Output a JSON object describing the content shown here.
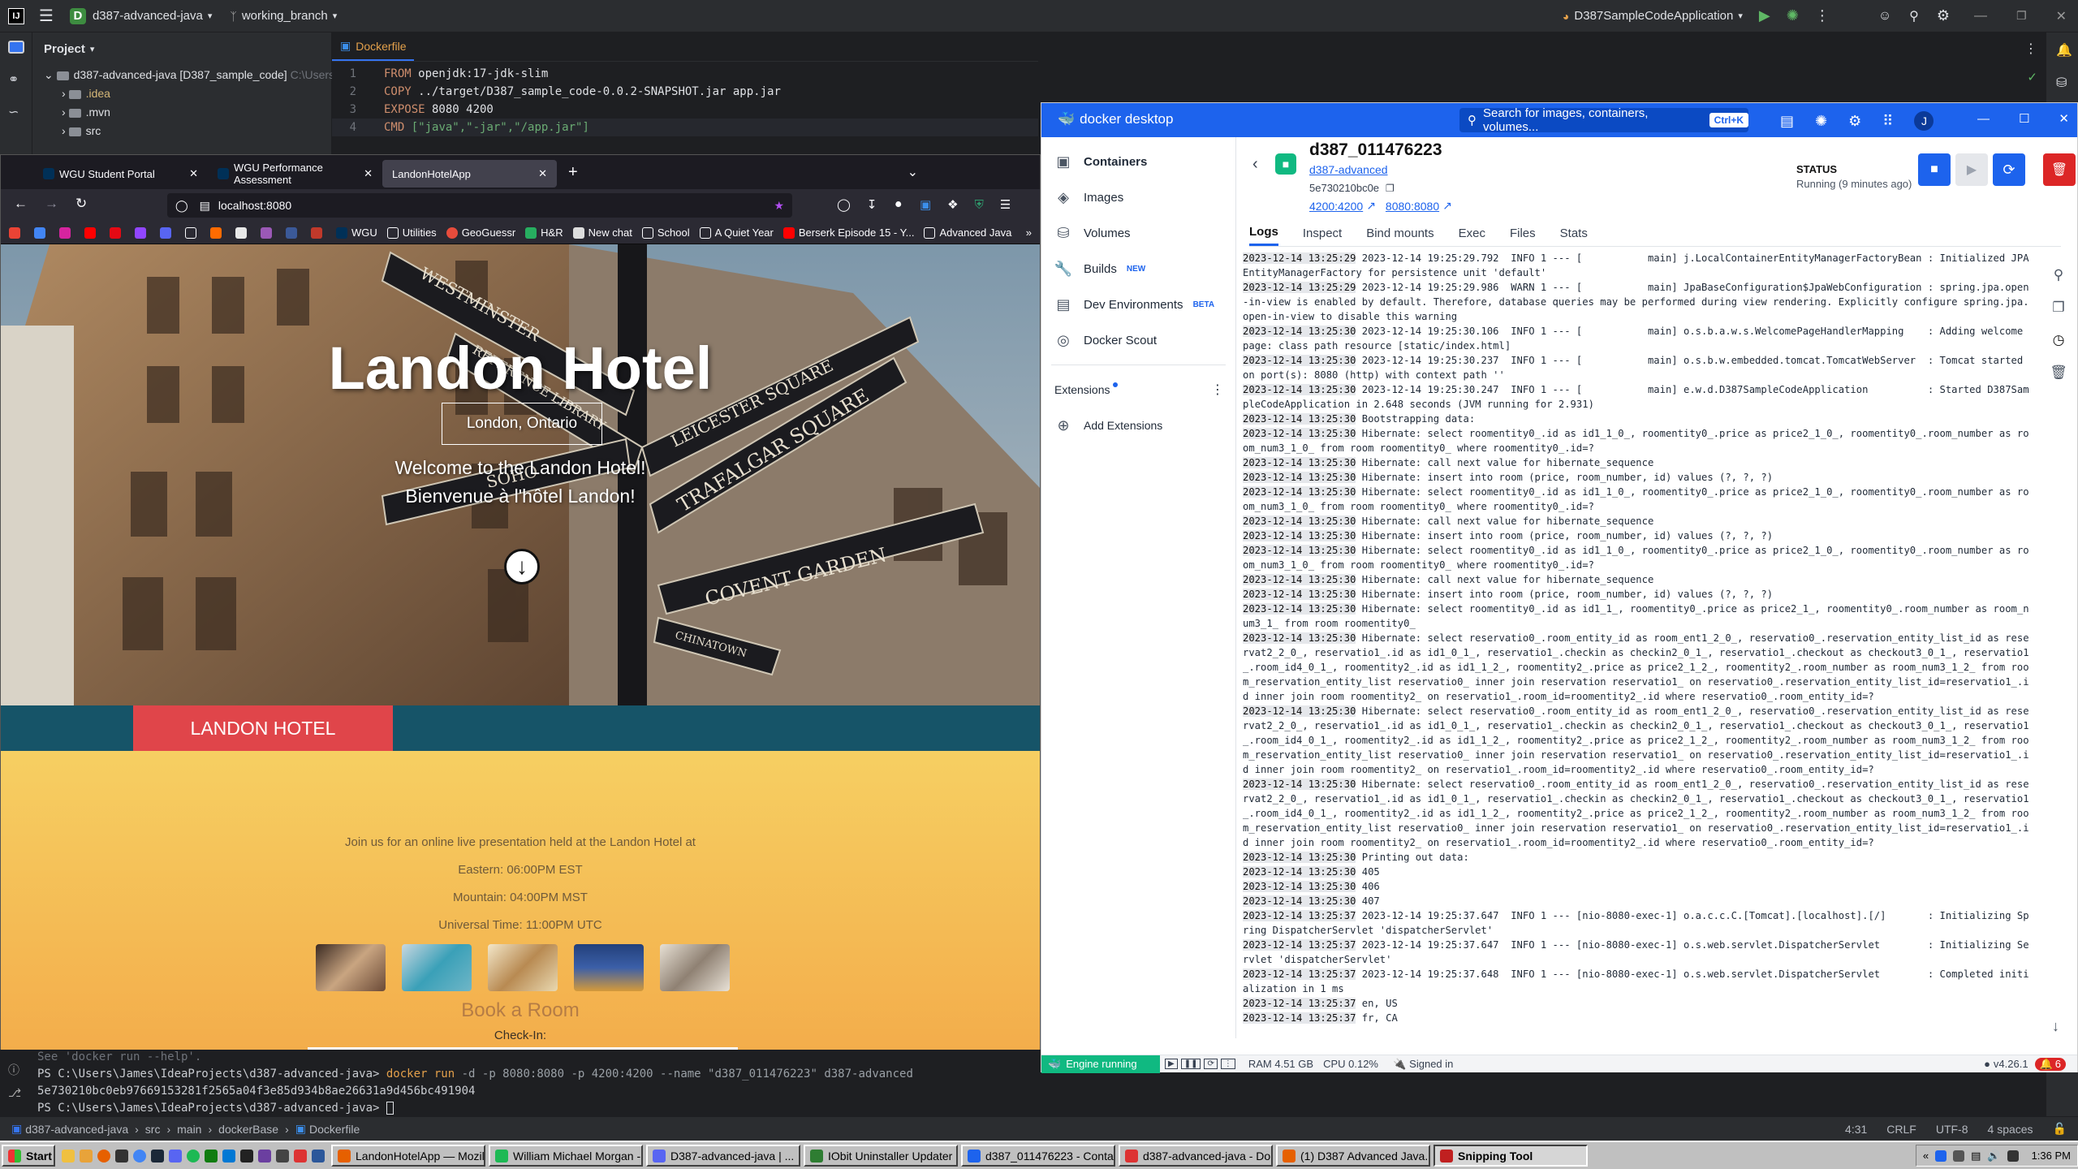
{
  "ide": {
    "project_name": "d387-advanced-java",
    "branch": "working_branch",
    "run_config": "D387SampleCodeApplication",
    "project_panel_title": "Project",
    "tree": [
      {
        "label": "d387-advanced-java [D387_sample_code]",
        "path": "C:\\Users"
      },
      {
        "label": ".idea"
      },
      {
        "label": ".mvn"
      },
      {
        "label": "src"
      }
    ],
    "editor_tab": "Dockerfile",
    "code_lines": [
      {
        "n": "1",
        "kw": "FROM",
        "rest": " openjdk:17-jdk-slim"
      },
      {
        "n": "2",
        "kw": "COPY",
        "rest": " ../target/D387_sample_code-0.0.2-SNAPSHOT.jar app.jar"
      },
      {
        "n": "3",
        "kw": "EXPOSE",
        "rest": " 8080 4200"
      },
      {
        "n": "4",
        "kw": "CMD",
        "rest": " [\"java\",\"-jar\",\"/app.jar\"]"
      }
    ],
    "terminal": {
      "line0": "See 'docker run --help'.",
      "prompt1": "PS C:\\Users\\James\\IdeaProjects\\d387-advanced-java> ",
      "cmd1": "docker run",
      "args1": " -d -p 8080:8080 -p 4200:4200 --name \"d387_011476223\" d387-advanced",
      "hash": "5e730210bc0eb97669153281f2565a04f3e85d934b8ae26631a9d456bc491904",
      "prompt2": "PS C:\\Users\\James\\IdeaProjects\\d387-advanced-java> "
    },
    "breadcrumbs": [
      "d387-advanced-java",
      "src",
      "main",
      "dockerBase",
      "Dockerfile"
    ],
    "status_right": {
      "pos": "4:31",
      "eol": "CRLF",
      "enc": "UTF-8",
      "indent": "4 spaces"
    }
  },
  "firefox": {
    "tabs": [
      "WGU Student Portal",
      "WGU Performance Assessment",
      "LandonHotelApp"
    ],
    "url": "localhost:8080",
    "bookmarks": [
      "WGU",
      "Utilities",
      "GeoGuessr",
      "H&R",
      "New chat",
      "School",
      "A Quiet Year",
      "Berserk Episode 15 - Y...",
      "Advanced Java"
    ],
    "site": {
      "title": "Landon Hotel",
      "location": "London, Ontario",
      "welcome_en": "Welcome to the Landon Hotel!",
      "welcome_fr": "Bienvenue à l'hôtel Landon!",
      "banner": "LANDON HOTEL",
      "event_intro": "Join us for an online live presentation held at the Landon Hotel at",
      "times": [
        "Eastern: 06:00PM EST",
        "Mountain: 04:00PM MST",
        "Universal Time: 11:00PM UTC"
      ],
      "book_title": "Book a Room",
      "checkin_label": "Check-In:",
      "signs": [
        "WESTMINSTER",
        "REFERENCE LIBRARY",
        "LEICESTER SQUARE",
        "TRAFALGAR SQUARE",
        "SOHO",
        "COVENT GARDEN",
        "CHINATOWN"
      ]
    }
  },
  "docker": {
    "app_title": "docker desktop",
    "search_placeholder": "Search for images, containers, volumes...",
    "search_shortcut": "Ctrl+K",
    "avatar": "J",
    "nav": [
      {
        "label": "Containers",
        "icon": "containers-icon"
      },
      {
        "label": "Images",
        "icon": "images-icon"
      },
      {
        "label": "Volumes",
        "icon": "volumes-icon"
      },
      {
        "label": "Builds",
        "icon": "builds-icon",
        "badge": "NEW"
      },
      {
        "label": "Dev Environments",
        "icon": "dev-env-icon",
        "badge": "BETA"
      },
      {
        "label": "Docker Scout",
        "icon": "scout-icon"
      }
    ],
    "extensions_label": "Extensions",
    "add_extensions": "Add Extensions",
    "container": {
      "name": "d387_011476223",
      "image": "d387-advanced",
      "id": "5e730210bc0e",
      "port1": "4200:4200",
      "port2": "8080:8080",
      "status_label": "STATUS",
      "status": "Running (9 minutes ago)"
    },
    "tabs": [
      "Logs",
      "Inspect",
      "Bind mounts",
      "Exec",
      "Files",
      "Stats"
    ],
    "logs": [
      {
        "ts": "2023-12-14 13:25:29",
        "msg": " 2023-12-14 19:25:29.792  INFO 1 --- [           main] j.LocalContainerEntityManagerFactoryBean : Initialized JPA EntityManagerFactory for persistence unit 'default'"
      },
      {
        "ts": "2023-12-14 13:25:29",
        "msg": " 2023-12-14 19:25:29.986  WARN 1 --- [           main] JpaBaseConfiguration$JpaWebConfiguration : spring.jpa.open-in-view is enabled by default. Therefore, database queries may be performed during view rendering. Explicitly configure spring.jpa.open-in-view to disable this warning"
      },
      {
        "ts": "2023-12-14 13:25:30",
        "msg": " 2023-12-14 19:25:30.106  INFO 1 --- [           main] o.s.b.a.w.s.WelcomePageHandlerMapping    : Adding welcome page: class path resource [static/index.html]"
      },
      {
        "ts": "2023-12-14 13:25:30",
        "msg": " 2023-12-14 19:25:30.237  INFO 1 --- [           main] o.s.b.w.embedded.tomcat.TomcatWebServer  : Tomcat started on port(s): 8080 (http) with context path ''"
      },
      {
        "ts": "2023-12-14 13:25:30",
        "msg": " 2023-12-14 19:25:30.247  INFO 1 --- [           main] e.w.d.D387SampleCodeApplication          : Started D387SampleCodeApplication in 2.648 seconds (JVM running for 2.931)"
      },
      {
        "ts": "2023-12-14 13:25:30",
        "msg": " Bootstrapping data:"
      },
      {
        "ts": "2023-12-14 13:25:30",
        "msg": " Hibernate: select roomentity0_.id as id1_1_0_, roomentity0_.price as price2_1_0_, roomentity0_.room_number as room_num3_1_0_ from room roomentity0_ where roomentity0_.id=?"
      },
      {
        "ts": "2023-12-14 13:25:30",
        "msg": " Hibernate: call next value for hibernate_sequence"
      },
      {
        "ts": "2023-12-14 13:25:30",
        "msg": " Hibernate: insert into room (price, room_number, id) values (?, ?, ?)"
      },
      {
        "ts": "2023-12-14 13:25:30",
        "msg": " Hibernate: select roomentity0_.id as id1_1_0_, roomentity0_.price as price2_1_0_, roomentity0_.room_number as room_num3_1_0_ from room roomentity0_ where roomentity0_.id=?"
      },
      {
        "ts": "2023-12-14 13:25:30",
        "msg": " Hibernate: call next value for hibernate_sequence"
      },
      {
        "ts": "2023-12-14 13:25:30",
        "msg": " Hibernate: insert into room (price, room_number, id) values (?, ?, ?)"
      },
      {
        "ts": "2023-12-14 13:25:30",
        "msg": " Hibernate: select roomentity0_.id as id1_1_0_, roomentity0_.price as price2_1_0_, roomentity0_.room_number as room_num3_1_0_ from room roomentity0_ where roomentity0_.id=?"
      },
      {
        "ts": "2023-12-14 13:25:30",
        "msg": " Hibernate: call next value for hibernate_sequence"
      },
      {
        "ts": "2023-12-14 13:25:30",
        "msg": " Hibernate: insert into room (price, room_number, id) values (?, ?, ?)"
      },
      {
        "ts": "2023-12-14 13:25:30",
        "msg": " Hibernate: select roomentity0_.id as id1_1_, roomentity0_.price as price2_1_, roomentity0_.room_number as room_num3_1_ from room roomentity0_"
      },
      {
        "ts": "2023-12-14 13:25:30",
        "msg": " Hibernate: select reservatio0_.room_entity_id as room_ent1_2_0_, reservatio0_.reservation_entity_list_id as reservat2_2_0_, reservatio1_.id as id1_0_1_, reservatio1_.checkin as checkin2_0_1_, reservatio1_.checkout as checkout3_0_1_, reservatio1_.room_id4_0_1_, roomentity2_.id as id1_1_2_, roomentity2_.price as price2_1_2_, roomentity2_.room_number as room_num3_1_2_ from room_reservation_entity_list reservatio0_ inner join reservation reservatio1_ on reservatio0_.reservation_entity_list_id=reservatio1_.id inner join room roomentity2_ on reservatio1_.room_id=roomentity2_.id where reservatio0_.room_entity_id=?"
      },
      {
        "ts": "2023-12-14 13:25:30",
        "msg": " Hibernate: select reservatio0_.room_entity_id as room_ent1_2_0_, reservatio0_.reservation_entity_list_id as reservat2_2_0_, reservatio1_.id as id1_0_1_, reservatio1_.checkin as checkin2_0_1_, reservatio1_.checkout as checkout3_0_1_, reservatio1_.room_id4_0_1_, roomentity2_.id as id1_1_2_, roomentity2_.price as price2_1_2_, roomentity2_.room_number as room_num3_1_2_ from room_reservation_entity_list reservatio0_ inner join reservation reservatio1_ on reservatio0_.reservation_entity_list_id=reservatio1_.id inner join room roomentity2_ on reservatio1_.room_id=roomentity2_.id where reservatio0_.room_entity_id=?"
      },
      {
        "ts": "2023-12-14 13:25:30",
        "msg": " Hibernate: select reservatio0_.room_entity_id as room_ent1_2_0_, reservatio0_.reservation_entity_list_id as reservat2_2_0_, reservatio1_.id as id1_0_1_, reservatio1_.checkin as checkin2_0_1_, reservatio1_.checkout as checkout3_0_1_, reservatio1_.room_id4_0_1_, roomentity2_.id as id1_1_2_, roomentity2_.price as price2_1_2_, roomentity2_.room_number as room_num3_1_2_ from room_reservation_entity_list reservatio0_ inner join reservation reservatio1_ on reservatio0_.reservation_entity_list_id=reservatio1_.id inner join room roomentity2_ on reservatio1_.room_id=roomentity2_.id where reservatio0_.room_entity_id=?"
      },
      {
        "ts": "2023-12-14 13:25:30",
        "msg": " Printing out data:"
      },
      {
        "ts": "2023-12-14 13:25:30",
        "msg": " 405"
      },
      {
        "ts": "2023-12-14 13:25:30",
        "msg": " 406"
      },
      {
        "ts": "2023-12-14 13:25:30",
        "msg": " 407"
      },
      {
        "ts": "2023-12-14 13:25:37",
        "msg": " 2023-12-14 19:25:37.647  INFO 1 --- [nio-8080-exec-1] o.a.c.c.C.[Tomcat].[localhost].[/]       : Initializing Spring DispatcherServlet 'dispatcherServlet'"
      },
      {
        "ts": "2023-12-14 13:25:37",
        "msg": " 2023-12-14 19:25:37.647  INFO 1 --- [nio-8080-exec-1] o.s.web.servlet.DispatcherServlet        : Initializing Servlet 'dispatcherServlet'"
      },
      {
        "ts": "2023-12-14 13:25:37",
        "msg": " 2023-12-14 19:25:37.648  INFO 1 --- [nio-8080-exec-1] o.s.web.servlet.DispatcherServlet        : Completed initialization in 1 ms"
      },
      {
        "ts": "2023-12-14 13:25:37",
        "msg": " en, US"
      },
      {
        "ts": "2023-12-14 13:25:37",
        "msg": " fr, CA"
      }
    ],
    "footer": {
      "engine": "Engine running",
      "ram": "RAM 4.51 GB",
      "cpu": "CPU 0.12%",
      "signed_in": "Signed in",
      "version": "v4.26.1",
      "notifications": "6"
    }
  },
  "taskbar": {
    "start": "Start",
    "apps": [
      {
        "label": "LandonHotelApp — Mozilla...",
        "color": "#e66000"
      },
      {
        "label": "William Michael Morgan - I...",
        "color": "#1db954"
      },
      {
        "label": "D387-advanced-java | ...",
        "color": "#5865f2",
        "pressed": true
      },
      {
        "label": "IObit Uninstaller Updater",
        "color": "#2e7d32"
      },
      {
        "label": "d387_011476223 - Contai...",
        "color": "#1d63ed"
      },
      {
        "label": "d387-advanced-java - Do...",
        "color": "#d33"
      },
      {
        "label": "(1) D387 Advanced Java...",
        "color": "#e66000"
      },
      {
        "label": "Snipping Tool",
        "color": "#c02020",
        "pressed": true
      }
    ],
    "time": "1:36 PM"
  }
}
